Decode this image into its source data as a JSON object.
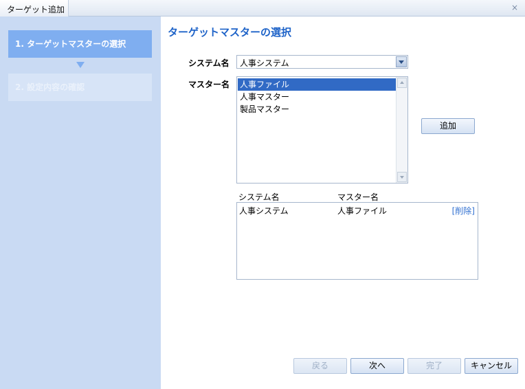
{
  "window": {
    "title": "ターゲット追加",
    "close_glyph": "×"
  },
  "sidebar": {
    "steps": [
      {
        "label": "1. ターゲットマスターの選択",
        "active": true
      },
      {
        "label": "2. 設定内容の確認",
        "active": false
      }
    ]
  },
  "main": {
    "title": "ターゲットマスターの選択",
    "system_label": "システム名",
    "system_value": "人事システム",
    "master_label": "マスター名",
    "master_options": [
      "人事ファイル",
      "人事マスター",
      "製品マスター"
    ],
    "selected_master_index": 0,
    "add_button": "追加",
    "grid": {
      "columns": [
        "システム名",
        "マスター名"
      ],
      "rows": [
        {
          "system": "人事システム",
          "master": "人事ファイル",
          "action": "[削除]"
        }
      ]
    }
  },
  "footer": {
    "back": "戻る",
    "next": "次へ",
    "finish": "完了",
    "cancel": "キャンセル"
  },
  "colors": {
    "accent": "#1e63c8",
    "sidebar_bg": "#c9daf3",
    "active_step": "#7faef0",
    "selection": "#316ac5"
  }
}
